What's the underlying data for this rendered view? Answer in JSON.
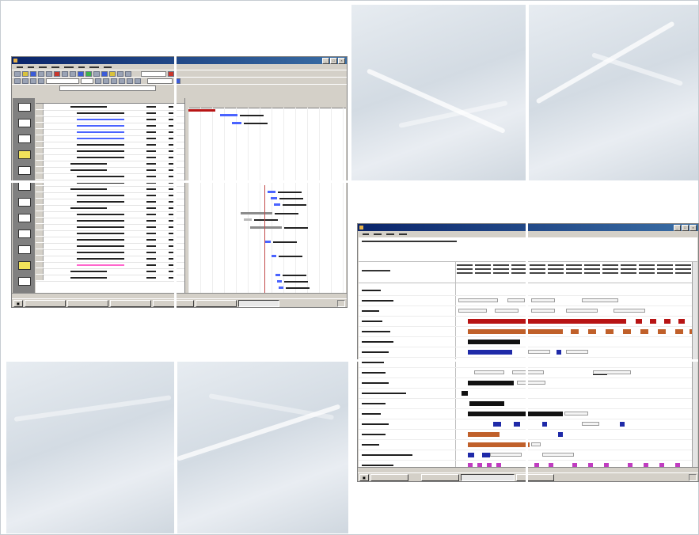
{
  "colors": {
    "page_bg": "#ffffff",
    "panel_blue": "#dde3e9",
    "title_bar": "#0a246a",
    "project_task_blue": "#4a63ff",
    "project_task_pink": "#ff66cc",
    "critical_red": "#b81414",
    "scheduler_orange": "#c0602a",
    "scheduler_blue": "#1f2aa8",
    "scheduler_magenta": "#c03cc0"
  },
  "icons": [
    "app-icon",
    "minimize-icon",
    "maximize-icon",
    "close-icon",
    "windows-start-icon",
    "outlook-bar-icon"
  ]
}
